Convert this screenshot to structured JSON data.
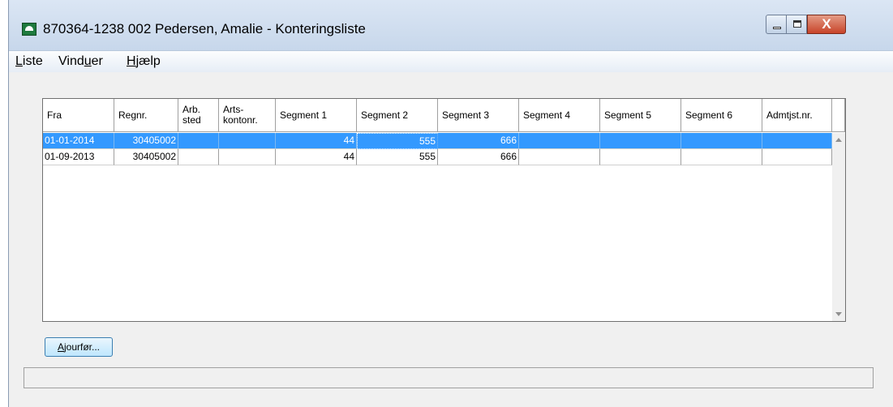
{
  "window": {
    "title": "870364-1238 002 Pedersen, Amalie - Konteringsliste",
    "close_glyph": "X"
  },
  "menu": {
    "items": [
      {
        "label_ul": "L",
        "label_rest": "iste"
      },
      {
        "label_pre": "Vind",
        "label_ul": "u",
        "label_rest": "er"
      },
      {
        "label_ul": "H",
        "label_rest": "jælp"
      }
    ]
  },
  "table": {
    "columns": [
      "Fra",
      "Regnr.",
      "Arb.\nsted",
      "Arts-\nkontonr.",
      "Segment 1",
      "Segment 2",
      "Segment 3",
      "Segment 4",
      "Segment 5",
      "Segment 6",
      "Admtjst.nr."
    ],
    "rows": [
      {
        "selected": true,
        "cells": [
          "01-01-2014",
          "30405002",
          "",
          "",
          "44",
          "555",
          "666",
          "",
          "",
          "",
          ""
        ]
      },
      {
        "selected": false,
        "cells": [
          "01-09-2013",
          "30405002",
          "",
          "",
          "44",
          "555",
          "666",
          "",
          "",
          "",
          ""
        ]
      }
    ]
  },
  "buttons": {
    "update_ul": "A",
    "update_rest": "jourfør..."
  },
  "status": {
    "text": ""
  },
  "colors": {
    "selection": "#3399ff",
    "titlebar": "#c7d7eb",
    "close": "#c8442a"
  }
}
